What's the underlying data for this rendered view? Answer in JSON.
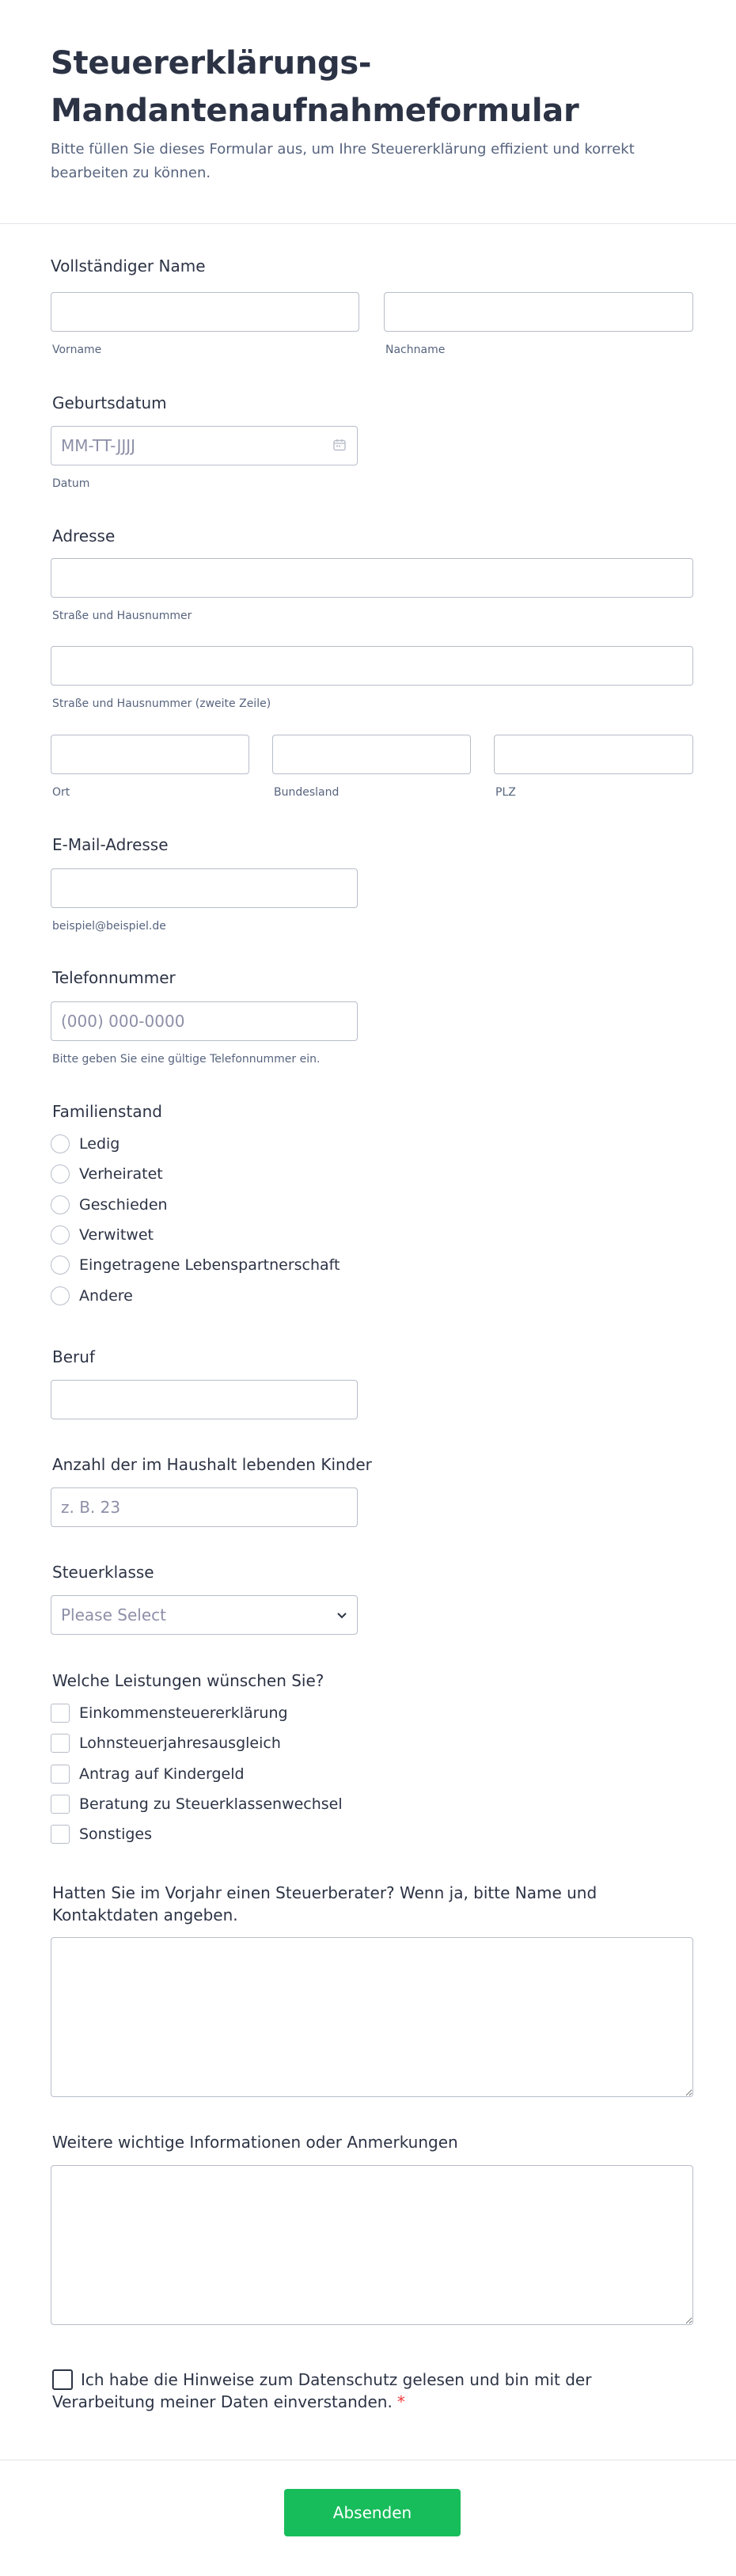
{
  "header": {
    "title_line1": "Steuererklärungs-",
    "title_line2": "Mandantenaufnahmeformular",
    "subtitle": "Bitte füllen Sie dieses Formular aus, um Ihre Steuererklärung effizient und korrekt bearbeiten zu können."
  },
  "name": {
    "label": "Vollständiger Name",
    "first_sublabel": "Vorname",
    "last_sublabel": "Nachname",
    "first_value": "",
    "last_value": ""
  },
  "birthdate": {
    "label": "Geburtsdatum",
    "placeholder": "MM-TT-JJJJ",
    "sublabel": "Datum",
    "icon": "calendar-icon"
  },
  "address": {
    "label": "Adresse",
    "street_sublabel": "Straße und Hausnummer",
    "street2_sublabel": "Straße und Hausnummer (zweite Zeile)",
    "city_sublabel": "Ort",
    "state_sublabel": "Bundesland",
    "zip_sublabel": "PLZ"
  },
  "email": {
    "label": "E-Mail-Adresse",
    "sublabel": "beispiel@beispiel.de"
  },
  "phone": {
    "label": "Telefonnummer",
    "placeholder": "(000) 000-0000",
    "sublabel": "Bitte geben Sie eine gültige Telefonnummer ein."
  },
  "marital": {
    "label": "Familienstand",
    "options": [
      "Ledig",
      "Verheiratet",
      "Geschieden",
      "Verwitwet",
      "Eingetragene Lebenspartnerschaft",
      "Andere"
    ]
  },
  "occupation": {
    "label": "Beruf"
  },
  "children": {
    "label": "Anzahl der im Haushalt lebenden Kinder",
    "placeholder": "z. B. 23"
  },
  "taxclass": {
    "label": "Steuerklasse",
    "selected": "Please Select",
    "icon": "chevron-down-icon"
  },
  "services": {
    "label": "Welche Leistungen wünschen Sie?",
    "options": [
      "Einkommensteuererklärung",
      "Lohnsteuerjahresausgleich",
      "Antrag auf Kindergeld",
      "Beratung zu Steuerklassenwechsel",
      "Sonstiges"
    ]
  },
  "previous_advisor": {
    "label": "Hatten Sie im Vorjahr einen Steuerberater? Wenn ja, bitte Name und Kontaktdaten angeben."
  },
  "notes": {
    "label": "Weitere wichtige Informationen oder Anmerkungen"
  },
  "consent": {
    "text": "Ich habe die Hinweise zum Datenschutz gelesen und bin mit der Verarbeitung meiner Daten einverstanden.",
    "required_mark": "*"
  },
  "submit": {
    "label": "Absenden"
  },
  "colors": {
    "submit": "#18bd5b",
    "required": "#f23a3c",
    "text": "#2c3345",
    "subtext": "#57647e",
    "border": "#b8bdc9"
  }
}
